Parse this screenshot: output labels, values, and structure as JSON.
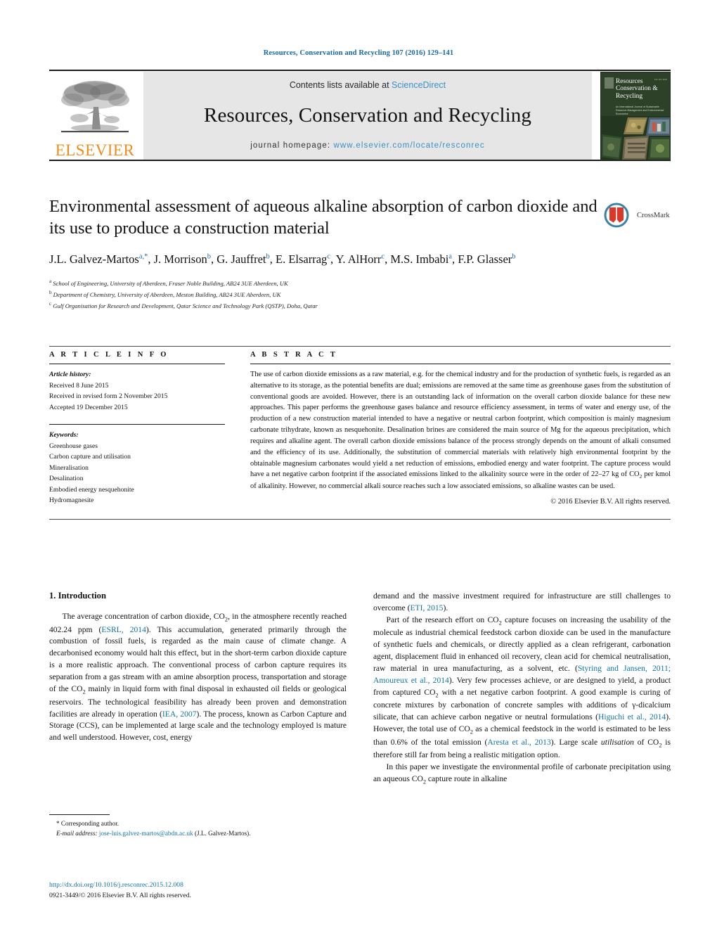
{
  "running_head": "Resources, Conservation and Recycling 107 (2016) 129–141",
  "masthead": {
    "publisher_name": "ELSEVIER",
    "contents_prefix": "Contents lists available at ",
    "contents_link": "ScienceDirect",
    "journal_name": "Resources, Conservation and Recycling",
    "homepage_prefix": "journal homepage: ",
    "homepage_url": "www.elsevier.com/locate/resconrec",
    "cover": {
      "title_line1": "Resources",
      "title_line2": "Conservation &",
      "title_line3": "Recycling",
      "subtitle": "An International Journal of Sustainable Resource Management and Environmental Economics",
      "issue_code": "Vol 107  2016"
    }
  },
  "article": {
    "title": "Environmental assessment of aqueous alkaline absorption of carbon dioxide and its use to produce a construction material",
    "crossmark_label": "CrossMark",
    "authors_html": "J.L. Galvez-Martos<sup>a,*</sup>, J. Morrison<sup>b</sup>, G. Jauffret<sup>b</sup>, E. Elsarrag<sup>c</sup>, Y. AlHorr<sup>c</sup>, M.S. Imbabi<sup>a</sup>, F.P. Glasser<sup>b</sup>",
    "affiliations": [
      "School of Engineering, University of Aberdeen, Fraser Noble Building, AB24 3UE Aberdeen, UK",
      "Department of Chemistry, University of Aberdeen, Meston Building, AB24 3UE Aberdeen, UK",
      "Gulf Organisation for Research and Development, Qatar Science and Technology Park (QSTP), Doha, Qatar"
    ],
    "affiliation_markers": [
      "a",
      "b",
      "c"
    ]
  },
  "article_info": {
    "heading": "A R T I C L E   I N F O",
    "history_label": "Article history:",
    "history": [
      "Received 8 June 2015",
      "Received in revised form 2 November 2015",
      "Accepted 19 December 2015"
    ],
    "keywords_label": "Keywords:",
    "keywords": [
      "Greenhouse gases",
      "Carbon capture and utilisation",
      "Mineralisation",
      "Desalination",
      "Embodied energy nesquehonite",
      "Hydromagnesite"
    ]
  },
  "abstract": {
    "heading": "A B S T R A C T",
    "text": "The use of carbon dioxide emissions as a raw material, e.g. for the chemical industry and for the production of synthetic fuels, is regarded as an alternative to its storage, as the potential benefits are dual; emissions are removed at the same time as greenhouse gases from the substitution of conventional goods are avoided. However, there is an outstanding lack of information on the overall carbon dioxide balance for these new approaches. This paper performs the greenhouse gases balance and resource efficiency assessment, in terms of water and energy use, of the production of a new construction material intended to have a negative or neutral carbon footprint, which composition is mainly magnesium carbonate trihydrate, known as nesquehonite. Desalination brines are considered the main source of Mg for the aqueous precipitation, which requires and alkaline agent. The overall carbon dioxide emissions balance of the process strongly depends on the amount of alkali consumed and the efficiency of its use. Additionally, the substitution of commercial materials with relatively high environmental footprint by the obtainable magnesium carbonates would yield a net reduction of emissions, embodied energy and water footprint. The capture process would have a net negative carbon footprint if the associated emissions linked to the alkalinity source were in the order of 22–27 kg of CO2 per kmol of alkalinity. However, no commercial alkali source reaches such a low associated emissions, so alkaline wastes can be used.",
    "copyright": "© 2016 Elsevier B.V. All rights reserved."
  },
  "introduction": {
    "heading": "1. Introduction",
    "left_paragraphs_html": [
      "The average concentration of carbon dioxide, CO<sub>2</sub>, in the atmosphere recently reached 402.24 ppm (<span class=\"ref\">ESRL, 2014</span>). This accumulation, generated primarily through the combustion of fossil fuels, is regarded as the main cause of climate change. A decarbonised economy would halt this effect, but in the short-term carbon dioxide capture is a more realistic approach. The conventional process of carbon capture requires its separation from a gas stream with an amine absorption process, transportation and storage of the CO<sub>2</sub> mainly in liquid form with final disposal in exhausted oil fields or geological reservoirs. The technological feasibility has already been proven and demonstration facilities are already in operation (<span class=\"ref\">IEA, 2007</span>). The process, known as Carbon Capture and Storage (CCS), can be implemented at large scale and the technology employed is mature and well understood. However, cost, energy"
    ],
    "right_paragraphs_html": [
      "demand and the massive investment required for infrastructure are still challenges to overcome (<span class=\"ref\">ETI, 2015</span>).",
      "Part of the research effort on CO<sub>2</sub> capture focuses on increasing the usability of the molecule as industrial chemical feedstock carbon dioxide can be used in the manufacture of synthetic fuels and chemicals, or directly applied as a clean refrigerant, carbonation agent, displacement fluid in enhanced oil recovery, clean acid for chemical neutralisation, raw material in urea manufacturing, as a solvent, etc. (<span class=\"ref\">Styring and Jansen, 2011; Amoureux et al., 2014</span>). Very few processes achieve, or are designed to yield, a product from captured CO<sub>2</sub> with a net negative carbon footprint. A good example is curing of concrete mixtures by carbonation of concrete samples with additions of γ-dicalcium silicate, that can achieve carbon negative or neutral formulations (<span class=\"ref\">Higuchi et al., 2014</span>). However, the total use of CO<sub>2</sub> as a chemical feedstock in the world is estimated to be less than 0.6% of the total emission (<span class=\"ref\">Aresta et al., 2013</span>). Large scale <i>utilisation</i> of CO<sub>2</sub> is therefore still far from being a realistic mitigation option.",
      "In this paper we investigate the environmental profile of carbonate precipitation using an aqueous CO<sub>2</sub> capture route in alkaline"
    ]
  },
  "footnote": {
    "corresponding": "* Corresponding author.",
    "email_label": "E-mail address:",
    "email": "jose-luis.galvez-martos@abdn.ac.uk",
    "email_owner": "(J.L. Galvez-Martos)."
  },
  "doi_block": {
    "doi_url": "http://dx.doi.org/10.1016/j.resconrec.2015.12.008",
    "issn_line": "0921-3449/© 2016 Elsevier B.V. All rights reserved."
  },
  "colors": {
    "link_blue": "#1274a8",
    "header_blue": "#1669a6",
    "elsevier_orange": "#f08c1b",
    "masthead_grey": "#e6e6e6",
    "cover_green": "#2c4127",
    "crossmark_red": "#d8392b",
    "crossmark_ring": "#3b82a8"
  }
}
